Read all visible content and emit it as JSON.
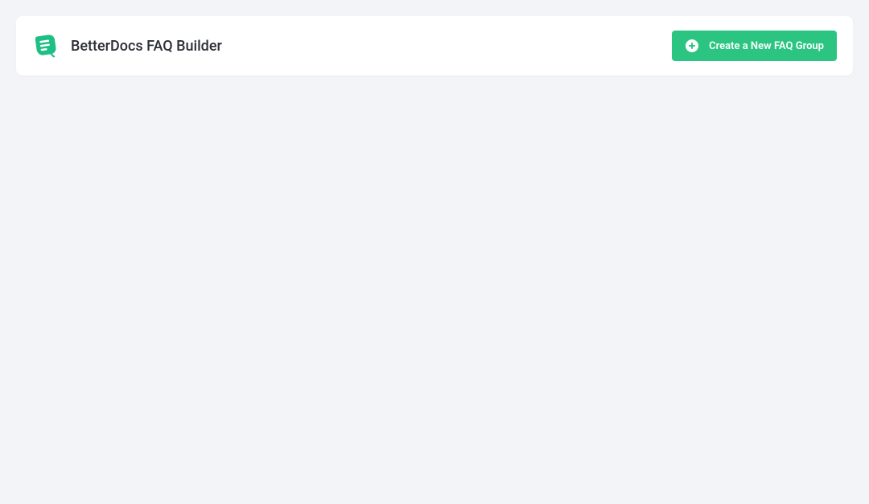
{
  "header": {
    "title": "BetterDocs FAQ Builder",
    "create_button_label": "Create a New FAQ Group"
  },
  "colors": {
    "accent": "#2bc581",
    "background": "#f3f4f7",
    "card": "#ffffff",
    "text": "#2c2f36"
  }
}
